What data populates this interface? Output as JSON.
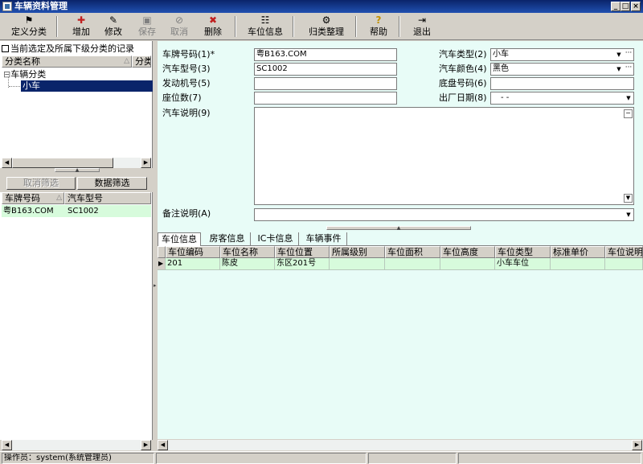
{
  "window": {
    "title": "车辆资料管理",
    "buttons": {
      "minimize": "_",
      "maximize": "□",
      "close": "×"
    }
  },
  "toolbar": {
    "items": [
      {
        "label": "定义分类",
        "icon": "define-category-icon",
        "glyph": "⚑",
        "enabled": true
      },
      {
        "label": "增加",
        "icon": "add-icon",
        "glyph": "✚",
        "enabled": true
      },
      {
        "label": "修改",
        "icon": "edit-icon",
        "glyph": "✎",
        "enabled": true
      },
      {
        "label": "保存",
        "icon": "save-icon",
        "glyph": "▣",
        "enabled": false
      },
      {
        "label": "取消",
        "icon": "cancel-icon",
        "glyph": "⊘",
        "enabled": false
      },
      {
        "label": "删除",
        "icon": "delete-icon",
        "glyph": "✖",
        "enabled": true
      },
      {
        "label": "车位信息",
        "icon": "parking-info-icon",
        "glyph": "☷",
        "enabled": true
      },
      {
        "label": "归类整理",
        "icon": "organize-icon",
        "glyph": "⚙",
        "enabled": true
      },
      {
        "label": "帮助",
        "icon": "help-icon",
        "glyph": "?",
        "enabled": true
      },
      {
        "label": "退出",
        "icon": "exit-icon",
        "glyph": "⇥",
        "enabled": true
      }
    ]
  },
  "left": {
    "checkbox_label": "当前选定及所属下级分类的记录",
    "tree_header": {
      "name": "分类名称",
      "col2": "分类"
    },
    "tree": {
      "root": "车辆分类",
      "root_toggle": "⊟",
      "child": "小车"
    },
    "filter_buttons": {
      "cancel": "取消筛选",
      "filter": "数据筛选"
    },
    "list_header": {
      "plate": "车牌号码",
      "model": "汽车型号"
    },
    "rows": [
      {
        "plate": "粤B163.COM",
        "model": "SC1002"
      }
    ]
  },
  "form": {
    "plate": {
      "label": "车牌号码(1)*",
      "value": "粤B163.COM"
    },
    "model": {
      "label": "汽车型号(3)",
      "value": "SC1002"
    },
    "engine": {
      "label": "发动机号(5)",
      "value": ""
    },
    "seats": {
      "label": "座位数(7)",
      "value": ""
    },
    "description": {
      "label": "汽车说明(9)",
      "value": ""
    },
    "remark": {
      "label": "备注说明(A)",
      "value": ""
    },
    "type": {
      "label": "汽车类型(2)",
      "value": "小车"
    },
    "color": {
      "label": "汽车颜色(4)",
      "value": "黑色"
    },
    "chassis": {
      "label": "底盘号码(6)",
      "value": ""
    },
    "date": {
      "label": "出厂日期(8)",
      "value": "-   -"
    }
  },
  "tabs": [
    "车位信息",
    "房客信息",
    "IC卡信息",
    "车辆事件"
  ],
  "grid": {
    "columns": [
      "车位编码",
      "车位名称",
      "车位位置",
      "所属级别",
      "车位面积",
      "车位高度",
      "车位类型",
      "标准单价",
      "车位说明"
    ],
    "rows": [
      [
        "201",
        "陈皮",
        "东区201号",
        "",
        "",
        "",
        "小车车位",
        "",
        ""
      ]
    ]
  },
  "status": {
    "operator": "操作员：system(系统管理员)"
  },
  "colors": {
    "form_bg": "#e8fcf7",
    "selected_row": "#0a246a",
    "grid_row": "#d7fbdc"
  }
}
